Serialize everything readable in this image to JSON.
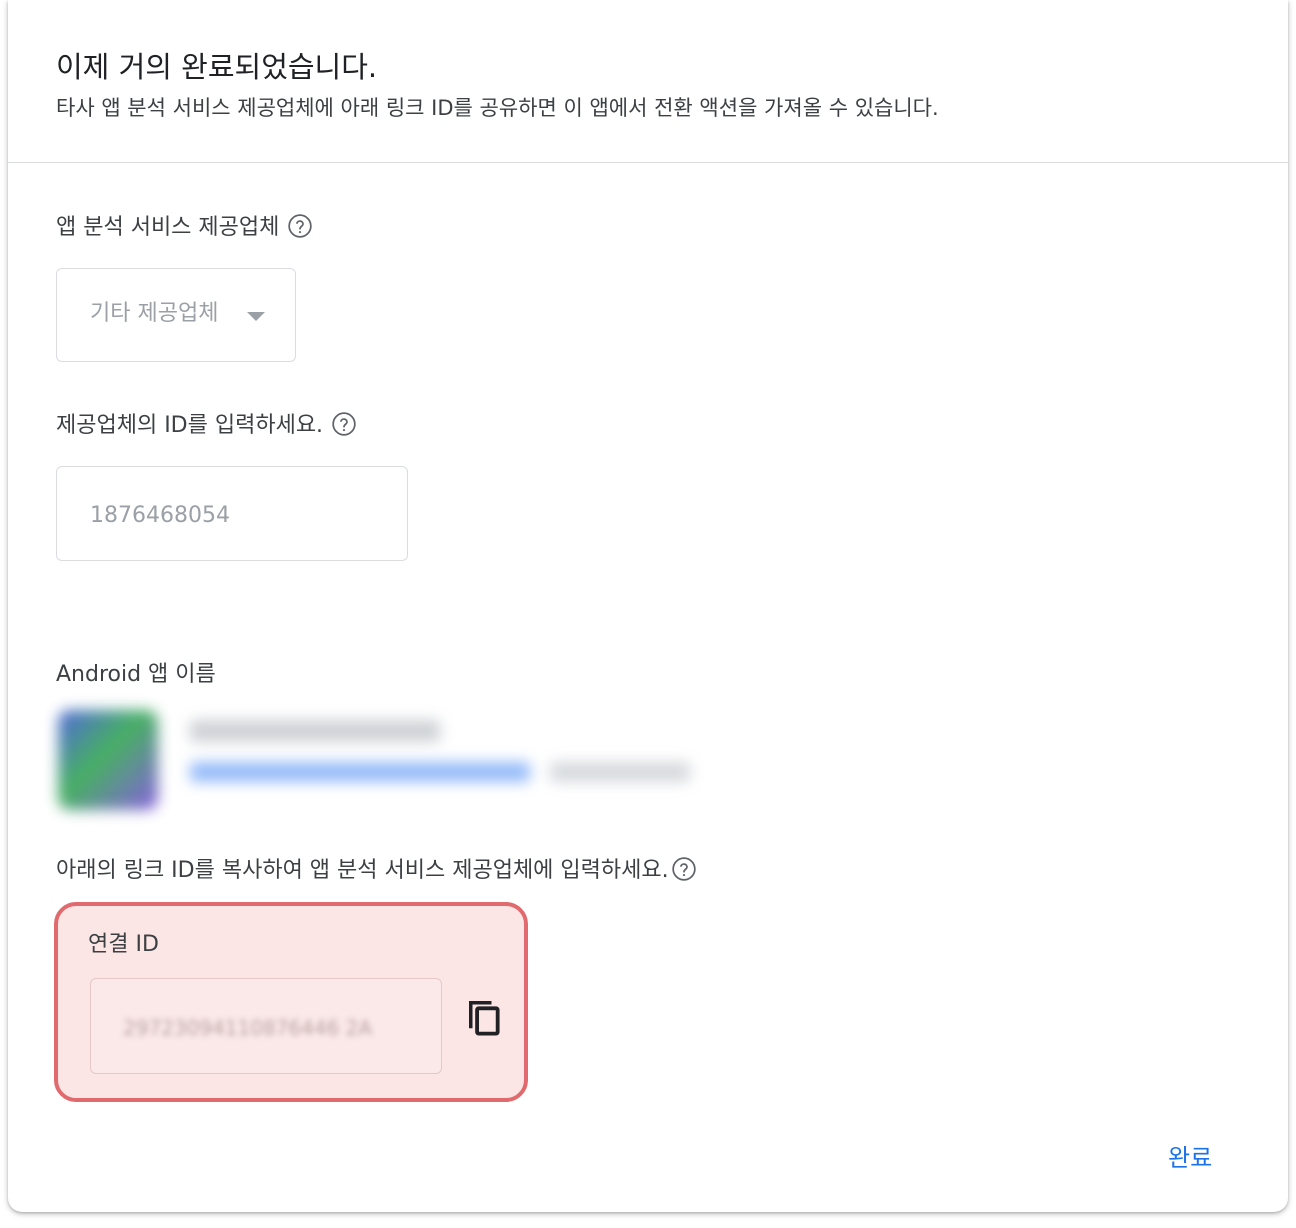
{
  "header": {
    "title": "이제 거의 완료되었습니다.",
    "subtitle": "타사 앱 분석 서비스 제공업체에 아래 링크 ID를 공유하면 이 앱에서 전환 액션을 가져올 수 있습니다."
  },
  "provider": {
    "label": "앱 분석 서비스 제공업체",
    "selected_value": "기타 제공업체"
  },
  "provider_id": {
    "label": "제공업체의 ID를 입력하세요.",
    "value": "1876468054"
  },
  "android_app": {
    "label": "Android 앱 이름"
  },
  "link_id": {
    "instruction": "아래의 링크 ID를 복사하여 앱 분석 서비스 제공업체에 입력하세요.",
    "label": "연결 ID",
    "value": "29723094110876446 2A"
  },
  "footer": {
    "done_label": "완료"
  },
  "colors": {
    "accent": "#1a73e8",
    "highlight_border": "#e06a6e",
    "highlight_fill": "#fbe5e5"
  },
  "icons": {
    "help": "help-circle-icon",
    "dropdown": "caret-down-icon",
    "copy": "copy-icon"
  }
}
